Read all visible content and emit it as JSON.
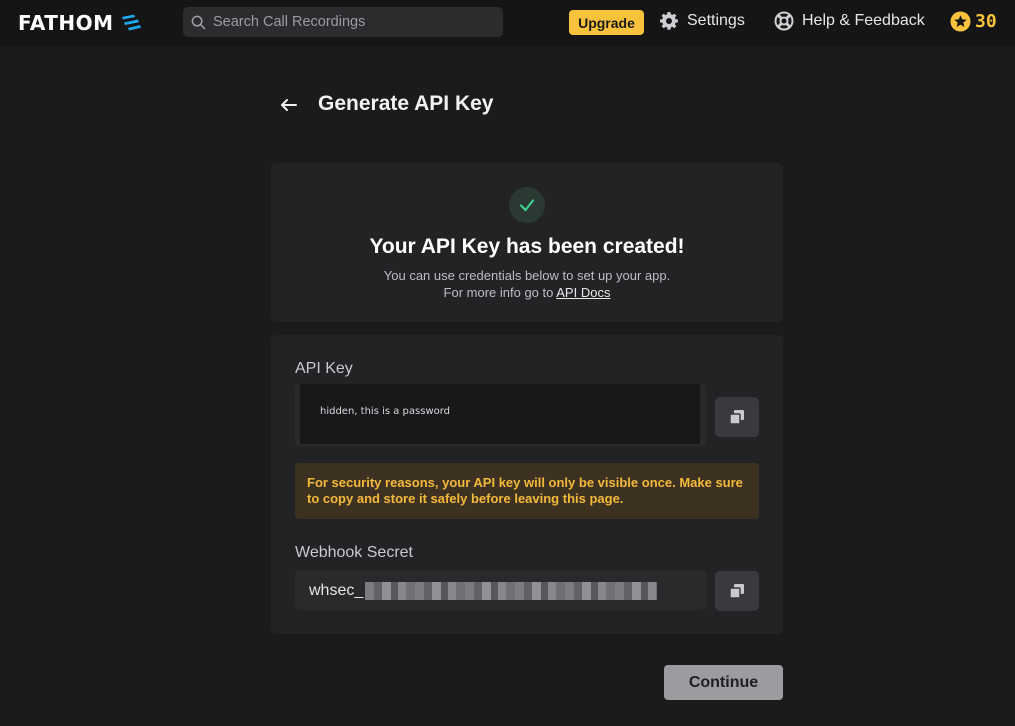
{
  "app": {
    "logo_text": "FATHOM"
  },
  "topbar": {
    "search_placeholder": "Search Call Recordings",
    "upgrade_label": "Upgrade",
    "settings_label": "Settings",
    "help_label": "Help & Feedback",
    "points": "30"
  },
  "page": {
    "title": "Generate API Key"
  },
  "success": {
    "title": "Your API Key has been created!",
    "line1": "You can use credentials below to set up your app.",
    "line2_prefix": "For more info go to ",
    "docs_link": "API Docs"
  },
  "credentials": {
    "api_key_label": "API Key",
    "api_key_value": "hidden, this is a password",
    "warning": "For security reasons, your API key will only be visible once. Make sure to copy and store it safely before leaving this page.",
    "webhook_label": "Webhook Secret",
    "webhook_prefix": "whsec_"
  },
  "actions": {
    "continue_label": "Continue"
  },
  "colors": {
    "accent": "#f9c23c",
    "success_check": "#3fcf8e",
    "warning_text": "#f5b93a",
    "background": "#1b1b1c"
  },
  "icons": {
    "logo": "fathom-logo-icon",
    "search": "search-icon",
    "settings": "gear-icon",
    "help": "lifebuoy-icon",
    "points": "star-coin-icon",
    "back": "arrow-left-icon",
    "check": "check-icon",
    "copy": "copy-icon"
  }
}
